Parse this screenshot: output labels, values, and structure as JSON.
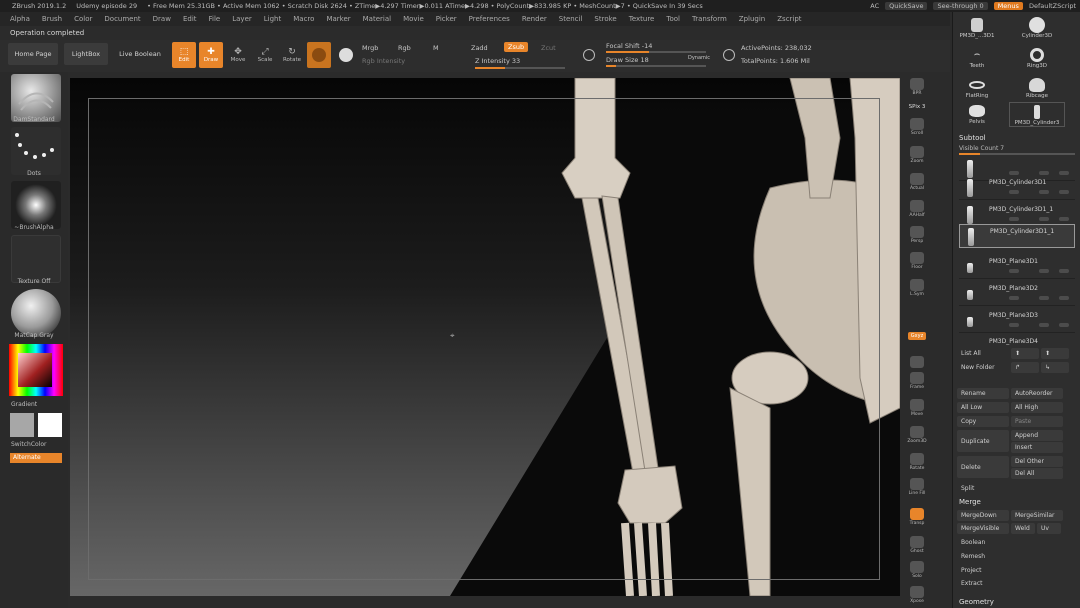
{
  "titlebar": {
    "items": [
      "ZBrush 2019.1.2",
      "Udemy episode 29",
      "• Free Mem 25.31GB • Active Mem 1062 • Scratch Disk 2624 • ZTime▶4.297 Timer▶0.011 ATime▶4.298 • PolyCount▶833.985 KP • MeshCount▶7 • QuickSave In 39 Secs"
    ],
    "ac": "AC",
    "quicksave": "QuickSave",
    "seethrough": "See-through  0",
    "menus": "Menus",
    "defaultzscript": "DefaultZScript"
  },
  "menubar": [
    "Alpha",
    "Brush",
    "Color",
    "Document",
    "Draw",
    "Edit",
    "File",
    "Layer",
    "Light",
    "Macro",
    "Marker",
    "Material",
    "Movie",
    "Picker",
    "Preferences",
    "Render",
    "Stencil",
    "Stroke",
    "Texture",
    "Tool",
    "Transform",
    "Zplugin",
    "Zscript"
  ],
  "notice": "Operation completed",
  "toolbar": {
    "home": "Home Page",
    "lightbox": "LightBox",
    "live_boolean": "Live Boolean",
    "edit": "Edit",
    "draw": "Draw",
    "move": "Move",
    "scale": "Scale",
    "rotate": "Rotate",
    "mrgb": "Mrgb",
    "rgb": "Rgb",
    "m": "M",
    "rgb_intensity": "Rgb Intensity",
    "zadd": "Zadd",
    "zsub": "Zsub",
    "zcut": "Zcut",
    "z_intensity": "Z Intensity 33",
    "focal_shift": "Focal Shift -14",
    "draw_size": "Draw Size 18",
    "dynamic": "Dynamic",
    "active_points": "ActivePoints: 238,032",
    "total_points": "TotalPoints: 1.606 Mil"
  },
  "leftpanel": {
    "brush": "DamStandard",
    "stroke": "Dots",
    "alpha": "~BrushAlpha",
    "texture": "Texture Off",
    "material": "MatCap Gray",
    "gradient": "Gradient",
    "switchcolor": "SwitchColor",
    "alternate": "Alternate"
  },
  "vtools": [
    "BPR",
    "SPix 3",
    "Scroll",
    "Zoom",
    "Actual",
    "AAHalf",
    "Persp",
    "Floor",
    "L.Sym",
    "Gxyz",
    "",
    "Frame",
    "Move",
    "Zoom3D",
    "Rotate",
    "Line Fill",
    "Transp",
    "Ghost",
    "Solo",
    "Xpose"
  ],
  "rightpanel": {
    "tools_top": [
      {
        "name": "PM3D_...3D1",
        "num": "3"
      },
      {
        "name": "Cylinder3D",
        "num": "7"
      },
      {
        "name": "Teeth",
        "num": "3"
      },
      {
        "name": "Ring3D",
        "num": ""
      },
      {
        "name": "FlatRing",
        "num": ""
      },
      {
        "name": "Ribcage",
        "num": "4"
      },
      {
        "name": "Pelvis",
        "num": "5"
      },
      {
        "name": "PM3D_Cylinder3",
        "num": "13"
      }
    ],
    "subtool_title": "Subtool",
    "visible_count": "Visible Count 7",
    "subtools": [
      "PM3D_Cylinder3D1",
      "PM3D_Cylinder3D1_1",
      "PM3D_Cylinder3D1_1",
      "PM3D_Plane3D1",
      "PM3D_Plane3D2",
      "PM3D_Plane3D3",
      "PM3D_Plane3D4"
    ],
    "list_all": "List All",
    "new_folder": "New Folder",
    "rename": "Rename",
    "autoreorder": "AutoReorder",
    "all_low": "All Low",
    "all_high": "All High",
    "copy": "Copy",
    "paste": "Paste",
    "duplicate": "Duplicate",
    "append": "Append",
    "insert": "Insert",
    "delete": "Delete",
    "del_other": "Del Other",
    "del_all": "Del All",
    "split": "Split",
    "merge_title": "Merge",
    "merge_down": "MergeDown",
    "merge_similar": "MergeSimilar",
    "merge_visible": "MergeVisible",
    "weld": "Weld",
    "uv": "Uv",
    "boolean": "Boolean",
    "remesh": "Remesh",
    "project": "Project",
    "extract": "Extract",
    "geometry": "Geometry"
  },
  "colors": {
    "accent": "#e8852a",
    "panel": "#2e2e2e",
    "bone": "#d8cfc2"
  }
}
